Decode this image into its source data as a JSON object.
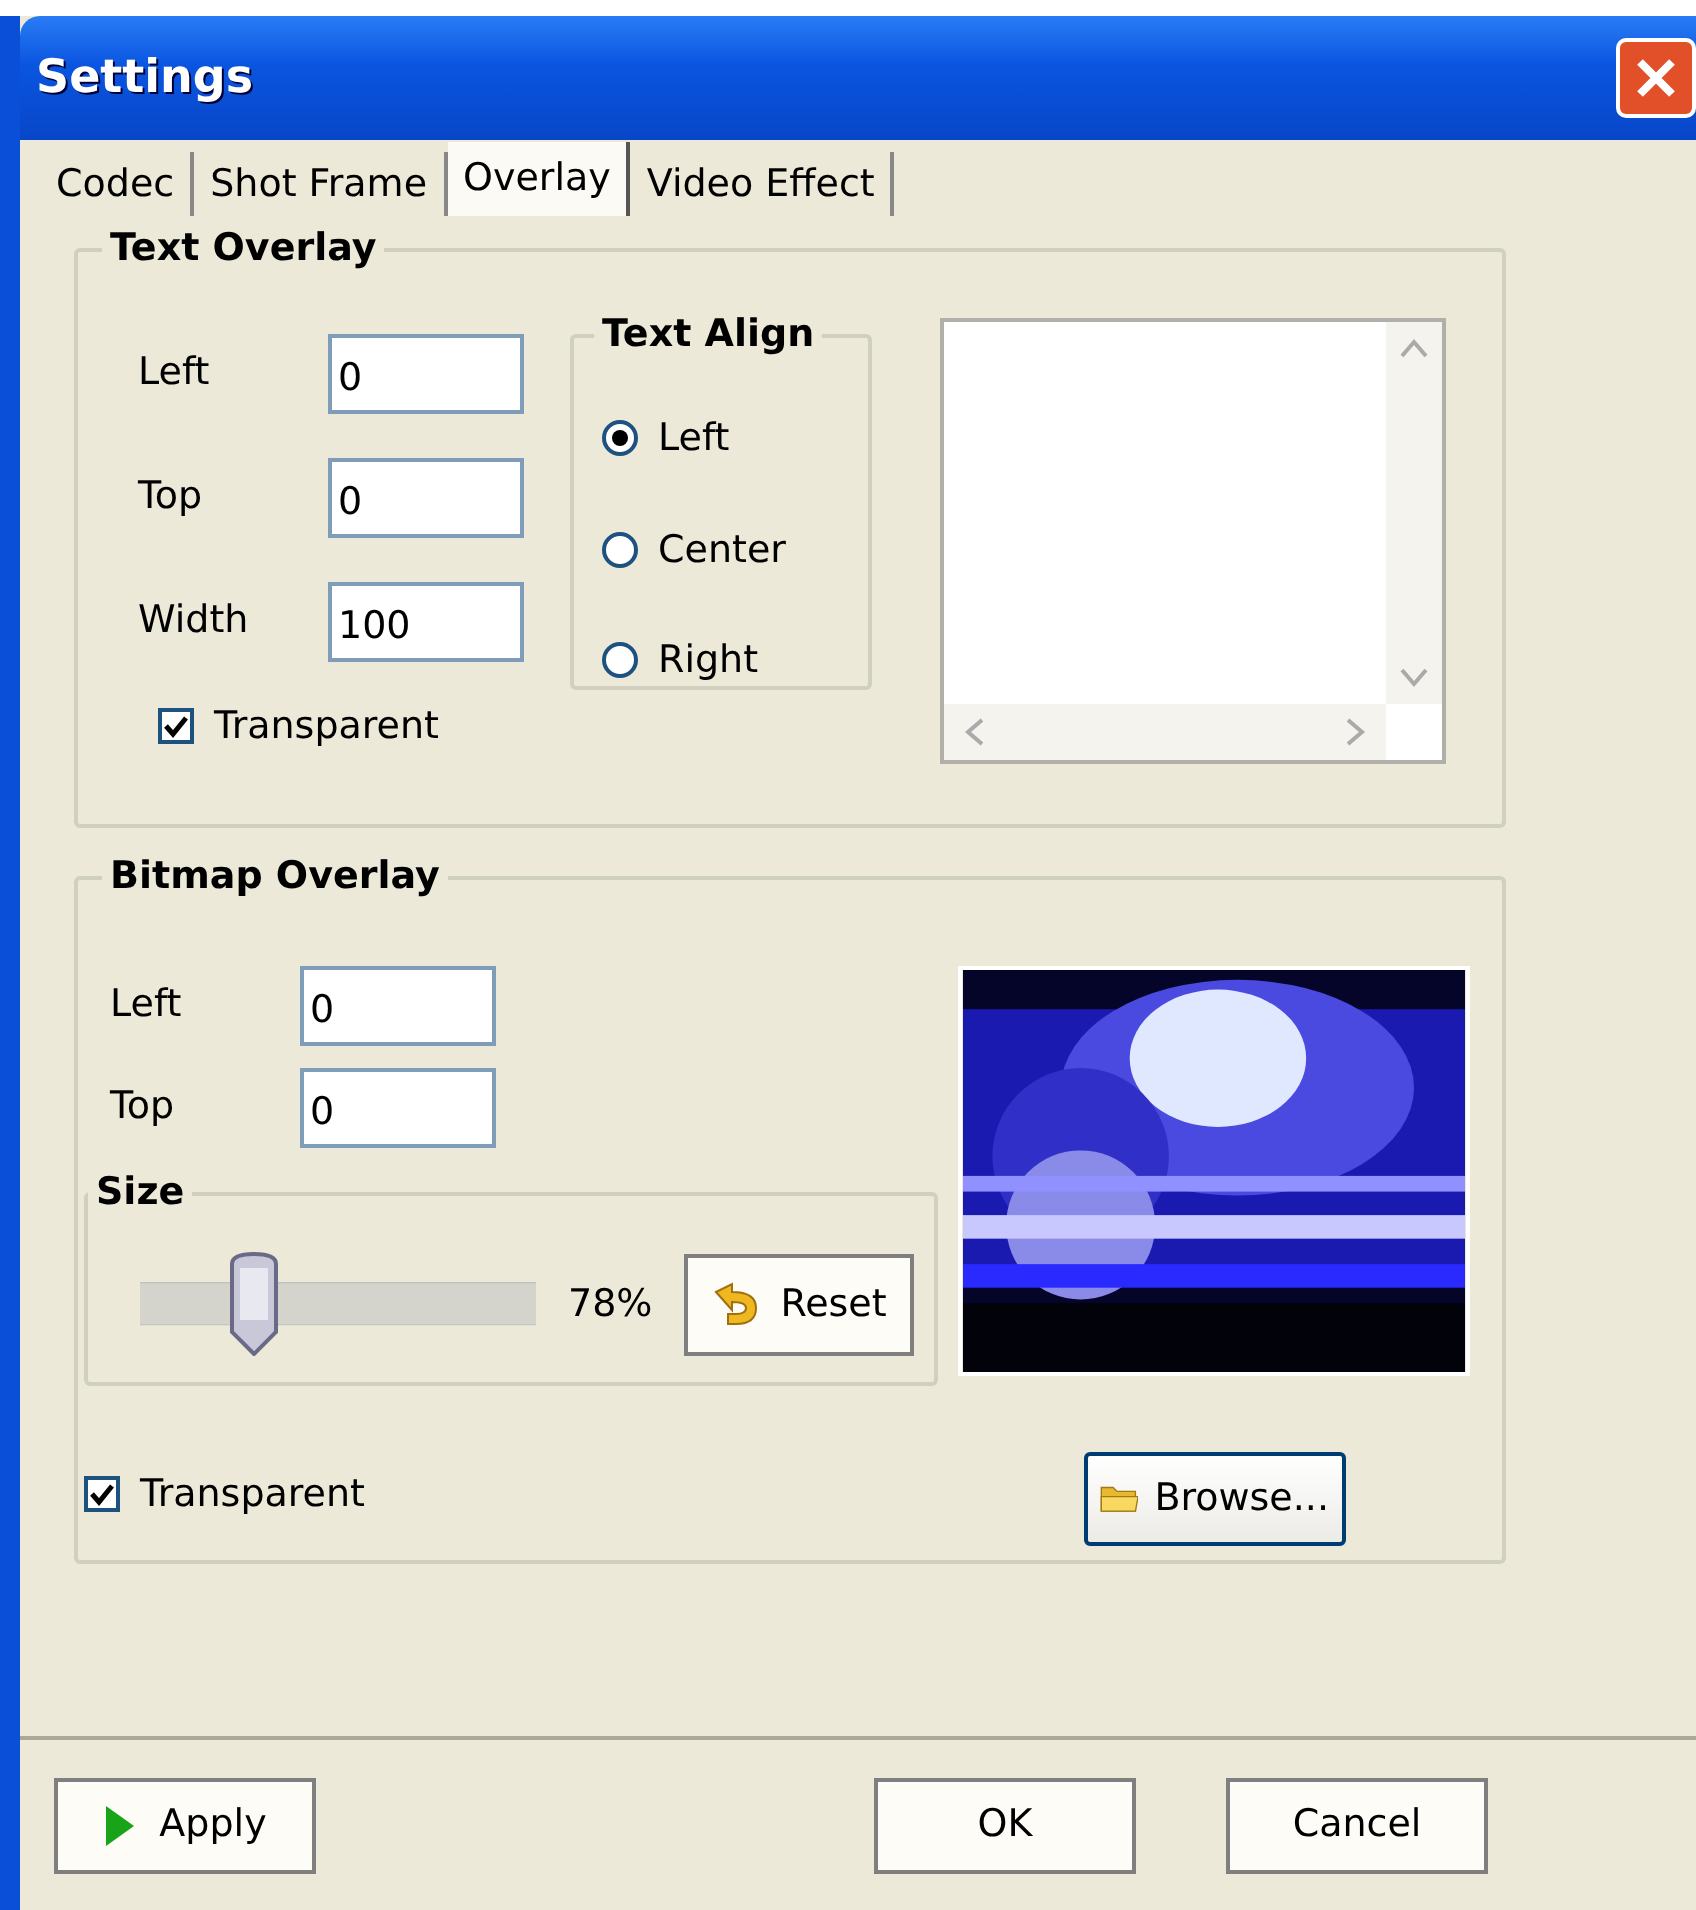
{
  "window": {
    "title": "Settings"
  },
  "tabs": [
    {
      "label": "Codec",
      "selected": false
    },
    {
      "label": "Shot Frame",
      "selected": false
    },
    {
      "label": "Overlay",
      "selected": true
    },
    {
      "label": "Video Effect",
      "selected": false
    }
  ],
  "text_overlay": {
    "title": "Text Overlay",
    "fields": [
      {
        "label": "Left",
        "value": "0"
      },
      {
        "label": "Top",
        "value": "0"
      },
      {
        "label": "Width",
        "value": "100"
      }
    ],
    "align": {
      "title": "Text Align",
      "options": [
        {
          "label": "Left",
          "selected": true
        },
        {
          "label": "Center",
          "selected": false
        },
        {
          "label": "Right",
          "selected": false
        }
      ]
    },
    "transparent": {
      "label": "Transparent",
      "checked": true
    }
  },
  "bitmap_overlay": {
    "title": "Bitmap Overlay",
    "fields": [
      {
        "label": "Left",
        "value": "0"
      },
      {
        "label": "Top",
        "value": "0"
      }
    ],
    "size": {
      "title": "Size",
      "level": 0.29,
      "reading": "78%",
      "reset_button": "Reset"
    },
    "transparent": {
      "label": "Transparent",
      "checked": true
    },
    "browse_button": "Browse..."
  },
  "buttons": [
    {
      "kind": "apply",
      "label": "Apply"
    },
    {
      "kind": "ok",
      "label": "OK"
    },
    {
      "kind": "cancel",
      "label": "Cancel"
    }
  ]
}
